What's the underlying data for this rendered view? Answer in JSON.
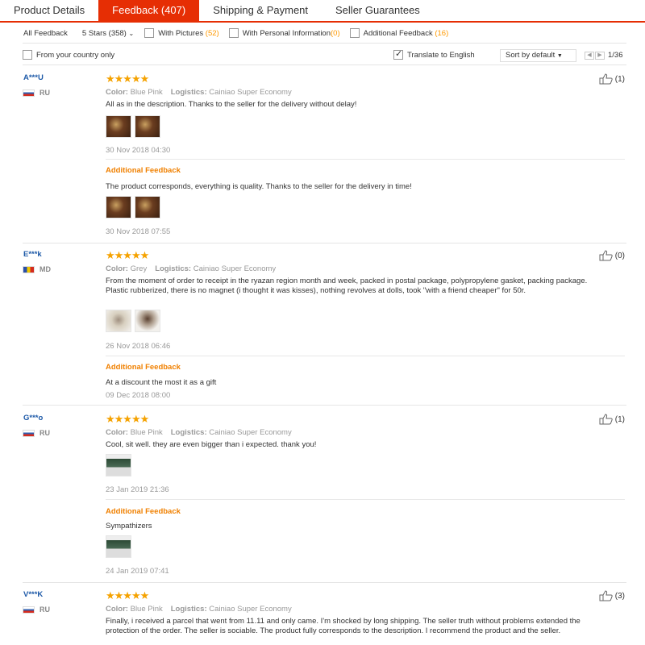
{
  "tabs": [
    {
      "label": "Product Details"
    },
    {
      "label": "Feedback (407)"
    },
    {
      "label": "Shipping & Payment"
    },
    {
      "label": "Seller Guarantees"
    }
  ],
  "filters": {
    "all_feedback": "All Feedback",
    "stars_select": "5 Stars (358)",
    "with_pictures": "With Pictures",
    "with_pictures_count": "(52)",
    "with_personal": "With Personal Information",
    "with_personal_count": "(0)",
    "additional": "Additional Feedback",
    "additional_count": "(16)",
    "from_country": "From your country only",
    "translate": "Translate to English",
    "translate_checked": true,
    "sort": "Sort by default",
    "page": "1/36"
  },
  "feedback": [
    {
      "user": "A***U",
      "country": "RU",
      "flag": "ru",
      "color": "Blue Pink",
      "logistics": "Cainiao Super Economy",
      "text": "All as in the description. Thanks to the seller for the delivery without delay!",
      "date": "30 Nov 2018 04:30",
      "likes": "(1)",
      "additional_text": "The product corresponds, everything is quality. Thanks to the seller for the delivery in time!",
      "additional_date": "30 Nov 2018 07:55"
    },
    {
      "user": "E***k",
      "country": "MD",
      "flag": "md",
      "color": "Grey",
      "logistics": "Cainiao Super Economy",
      "text": "From the moment of order to receipt in the ryazan region month and week, packed in postal package, polypropylene gasket, packing package. Plastic rubberized, there is no magnet (i thought it was kisses), nothing revolves at dolls, took \"with a friend cheaper\" for 50r.",
      "date": "26 Nov 2018 06:46",
      "likes": "(0)",
      "additional_text": "At a discount the most it as a gift",
      "additional_date": "09 Dec 2018 08:00"
    },
    {
      "user": "G***o",
      "country": "RU",
      "flag": "ru",
      "color": "Blue Pink",
      "logistics": "Cainiao Super Economy",
      "text": "Cool, sit well. they are even bigger than i expected. thank you!",
      "date": "23 Jan 2019 21:36",
      "likes": "(1)",
      "additional_text": "Sympathizers",
      "additional_date": "24 Jan 2019 07:41"
    },
    {
      "user": "V***K",
      "country": "RU",
      "flag": "ru",
      "color": "Blue Pink",
      "logistics": "Cainiao Super Economy",
      "text": "Finally, i received a parcel that went from 11.11 and only came. I'm shocked by long shipping. The seller truth without problems extended the protection of the order. The seller is sociable. The product fully corresponds to the description. I recommend the product and the seller.",
      "likes": "(3)"
    }
  ],
  "labels": {
    "color": "Color:",
    "logistics": "Logistics:",
    "additional_feedback": "Additional Feedback"
  },
  "stars": "★★★★★",
  "colors": {
    "accent": "#e62e04",
    "star": "#f5a200",
    "additional": "#f08000",
    "username": "#1e5aa8"
  }
}
